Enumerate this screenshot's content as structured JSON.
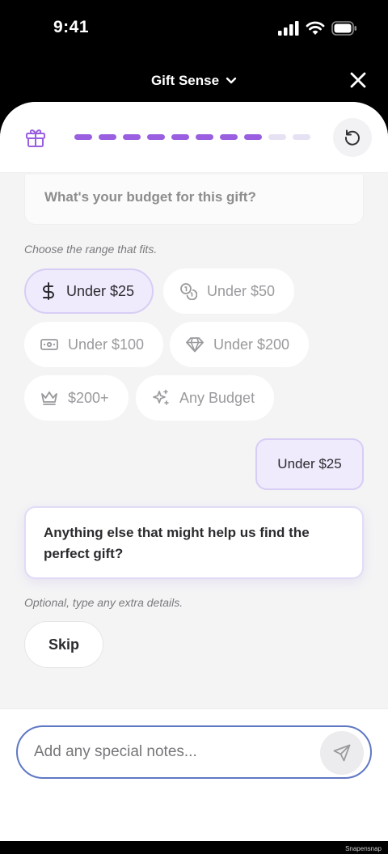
{
  "status": {
    "time": "9:41"
  },
  "nav": {
    "title": "Gift Sense"
  },
  "progress": {
    "total": 10,
    "completed": 8
  },
  "question": {
    "text": "What's your budget for this gift?"
  },
  "budget_hint": "Choose the range that fits.",
  "budget_options": [
    {
      "label": "Under $25",
      "icon": "dollar-icon",
      "selected": true
    },
    {
      "label": "Under $50",
      "icon": "coins-icon",
      "selected": false
    },
    {
      "label": "Under $100",
      "icon": "banknote-icon",
      "selected": false
    },
    {
      "label": "Under $200",
      "icon": "diamond-icon",
      "selected": false
    },
    {
      "label": "$200+",
      "icon": "crown-icon",
      "selected": false
    },
    {
      "label": "Any Budget",
      "icon": "sparkles-icon",
      "selected": false
    }
  ],
  "user_reply": "Under $25",
  "followup": {
    "text": "Anything else that might help us find the perfect gift?",
    "hint": "Optional, type any extra details.",
    "skip_label": "Skip"
  },
  "composer": {
    "placeholder": "Add any special notes..."
  },
  "watermark": "Snapensnap",
  "colors": {
    "accent": "#9a5fe0",
    "selected_bg": "#efeafc",
    "input_border": "#5f78c4"
  }
}
